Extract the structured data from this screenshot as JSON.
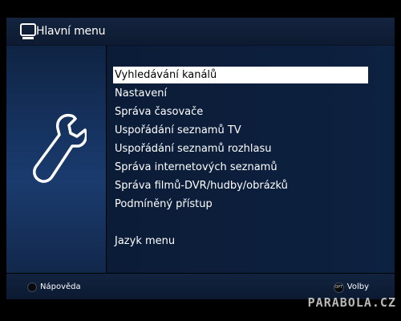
{
  "header": {
    "title": "Hlavní menu",
    "icon": "tv-icon"
  },
  "menu": {
    "items": [
      {
        "label": "Vyhledávání kanálů",
        "selected": true
      },
      {
        "label": "Nastavení",
        "selected": false
      },
      {
        "label": "Správa časovače",
        "selected": false
      },
      {
        "label": "Uspořádání seznamů TV",
        "selected": false
      },
      {
        "label": "Uspořádání seznamů rozhlasu",
        "selected": false
      },
      {
        "label": "Správa internetových seznamů",
        "selected": false
      },
      {
        "label": "Správa filmů-DVR/hudby/obrázků",
        "selected": false
      },
      {
        "label": "Podmíněný přístup",
        "selected": false
      },
      {
        "label": "Jazyk menu",
        "selected": false
      }
    ]
  },
  "left_panel": {
    "icon": "wrench-icon"
  },
  "footer": {
    "help_label": "Nápověda",
    "options_button": "OPT",
    "options_label": "Volby"
  },
  "watermark": "PARABOLA.CZ",
  "colors": {
    "background": "#000000",
    "panel_dark": "#0b1c37",
    "panel_left": "#163462",
    "selection": "#ffffff",
    "text": "#ffffff"
  }
}
